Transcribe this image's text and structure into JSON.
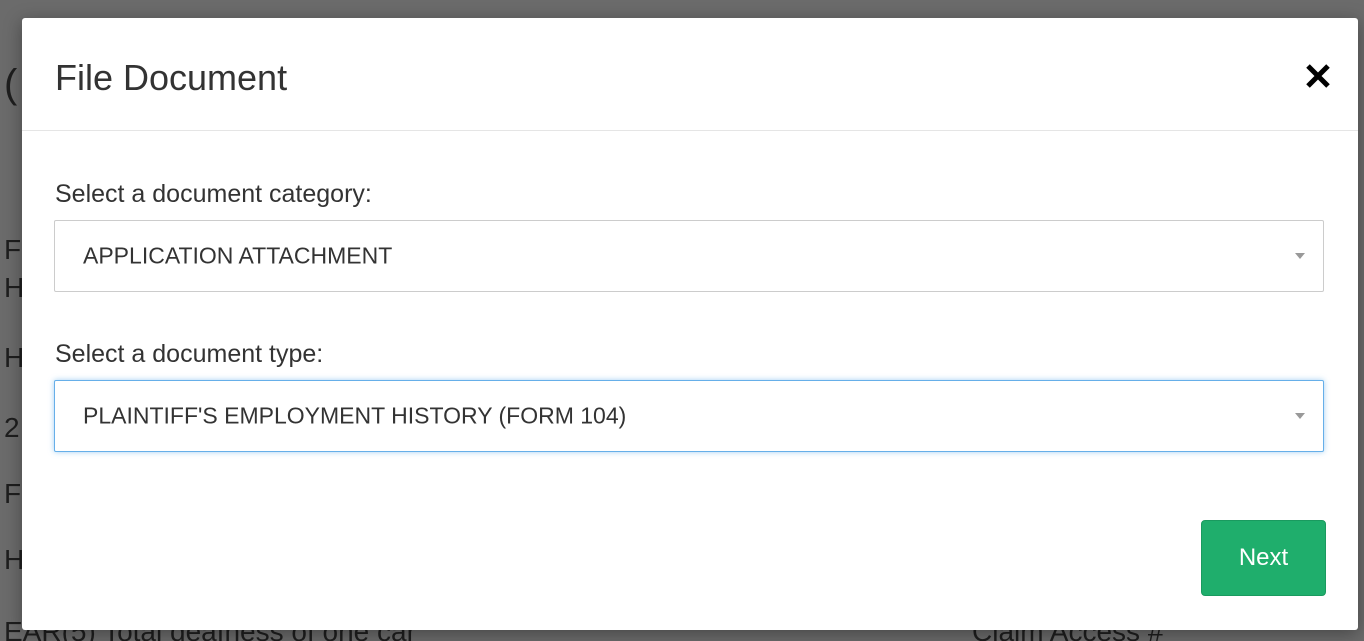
{
  "background": {
    "visible_text": [
      "(",
      "F",
      "H",
      "H",
      "2",
      "F",
      "H",
      "EAR(5) Total deafness of one car",
      "Claim Access #"
    ]
  },
  "modal": {
    "title": "File Document",
    "close_label": "×",
    "category": {
      "label": "Select a document category:",
      "value": "APPLICATION ATTACHMENT"
    },
    "type": {
      "label": "Select a document type:",
      "value": "PLAINTIFF'S EMPLOYMENT HISTORY (FORM 104)"
    },
    "next_label": "Next"
  },
  "colors": {
    "backdrop": "#6b6b6b",
    "primary_button": "#1fae6c",
    "focus_border": "#66afe9",
    "text": "#333333"
  },
  "icons": {
    "close": "close-icon",
    "dropdown": "chevron-down-icon"
  }
}
